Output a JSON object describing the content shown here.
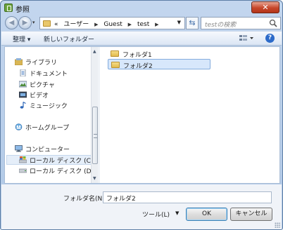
{
  "window": {
    "title": "参照",
    "close_label": "✕"
  },
  "address_bar": {
    "crumb_prefix": "«",
    "crumbs": [
      "ユーザー",
      "Guest",
      "test"
    ],
    "search_placeholder": "testの検索"
  },
  "toolbar": {
    "organize": "整理 ▾",
    "new_folder": "新しいフォルダー"
  },
  "nav_pane": {
    "items": [
      {
        "label": "ライブラリ",
        "icon": "library-icon"
      },
      {
        "label": "ドキュメント",
        "icon": "document-icon"
      },
      {
        "label": "ピクチャ",
        "icon": "picture-icon"
      },
      {
        "label": "ビデオ",
        "icon": "video-icon"
      },
      {
        "label": "ミュージック",
        "icon": "music-icon"
      },
      {
        "label": "ホームグループ",
        "icon": "homegroup-icon"
      },
      {
        "label": "コンピューター",
        "icon": "computer-icon"
      },
      {
        "label": "ローカル ディスク (C:)",
        "icon": "drive-icon"
      },
      {
        "label": "ローカル ディスク (D:)",
        "icon": "drive-icon"
      }
    ]
  },
  "files": [
    {
      "name": "フォルダ1",
      "selected": false
    },
    {
      "name": "フォルダ2",
      "selected": true
    }
  ],
  "footer": {
    "folder_name_label": "フォルダ名(N):",
    "folder_name_value": "フォルダ2",
    "tools_label": "ツール(L)",
    "ok_label": "OK",
    "cancel_label": "キャンセル"
  },
  "colors": {
    "selection": "#d7e7fb",
    "frame": "#c3d6ee",
    "close": "#c7472b"
  }
}
